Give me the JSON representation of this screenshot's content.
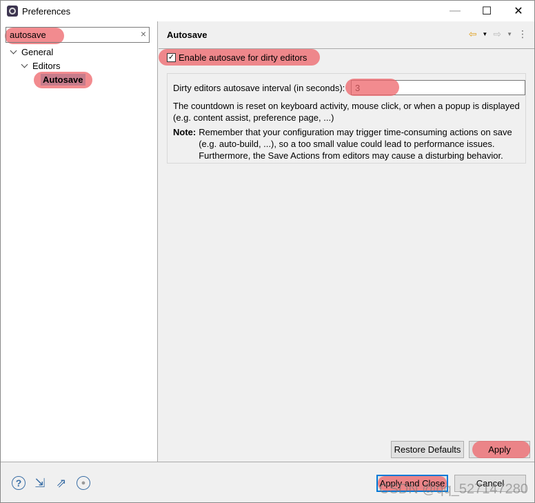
{
  "window": {
    "title": "Preferences",
    "minimize": "—",
    "maximize": "☐",
    "close": "✕"
  },
  "sidebar": {
    "search_value": "autosave",
    "clear_icon": "×",
    "tree": [
      {
        "label": "General",
        "expanded": true
      },
      {
        "label": "Editors",
        "expanded": true
      },
      {
        "label": "Autosave",
        "selected": true
      }
    ]
  },
  "page": {
    "title": "Autosave",
    "back_icon": "⇦",
    "forward_icon": "⇨",
    "menu_icon": "⋮",
    "enable_checkbox": {
      "label": "Enable autosave for dirty editors",
      "checked": true
    },
    "interval_label": "Dirty editors autosave interval (in seconds):",
    "interval_value": "3",
    "description": "The countdown is reset on keyboard activity, mouse click, or when a popup is displayed (e.g. content assist, preference page, ...)",
    "note_label": "Note:",
    "note_text": "Remember that your configuration may trigger time-consuming actions on save (e.g. auto-build, ...), so a too small value could lead to performance issues. Furthermore, the Save Actions from editors may cause a disturbing behavior.",
    "restore_defaults": "Restore Defaults",
    "apply": "Apply"
  },
  "footer": {
    "apply_close": "Apply and Close",
    "cancel": "Cancel"
  },
  "watermark": "CSDN @qq_527147280",
  "colors": {
    "highlight": "#ee6469",
    "selection": "#c77c8b",
    "focus": "#0078d7"
  }
}
